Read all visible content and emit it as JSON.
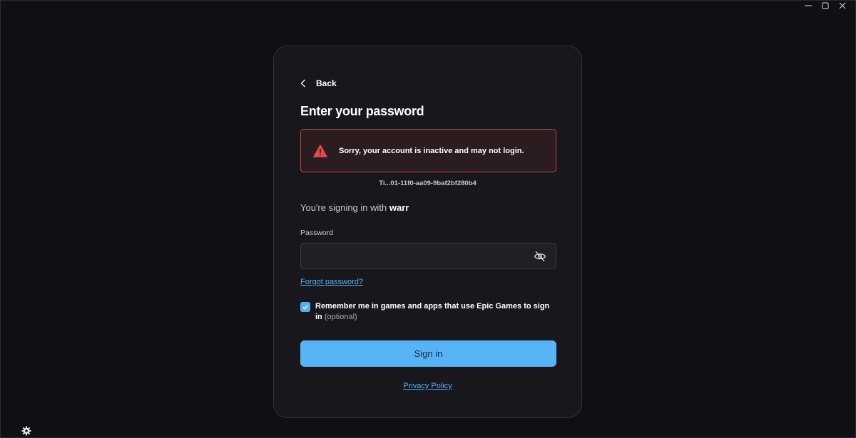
{
  "window": {
    "controls": [
      "minimize-icon",
      "maximize-icon",
      "close-icon"
    ]
  },
  "login": {
    "back_label": "Back",
    "title": "Enter your password",
    "error_message": "Sorry, your account is inactive and may not login.",
    "correlation_id": "Ti...01-11f0-aa09-9baf2bf280b4",
    "signing_prefix": "You're signing in with ",
    "signing_account": "warr",
    "password_label": "Password",
    "password_value": "",
    "forgot_password": "Forgot password?",
    "remember_checked": true,
    "remember_text": "Remember me in games and apps that use Epic Games to sign in",
    "remember_optional": "(optional)",
    "signin_button": "Sign in",
    "privacy_policy": "Privacy Policy"
  },
  "colors": {
    "background": "#101014",
    "card": "#18181c",
    "accent": "#55aef2",
    "error_border": "#b04a52",
    "warning_icon": "#e5484d"
  },
  "icons": {
    "back": "chevron-left-icon",
    "error": "warning-triangle-icon",
    "password_toggle": "eye-off-icon",
    "checkbox": "checkmark-icon",
    "settings": "gear-icon"
  }
}
